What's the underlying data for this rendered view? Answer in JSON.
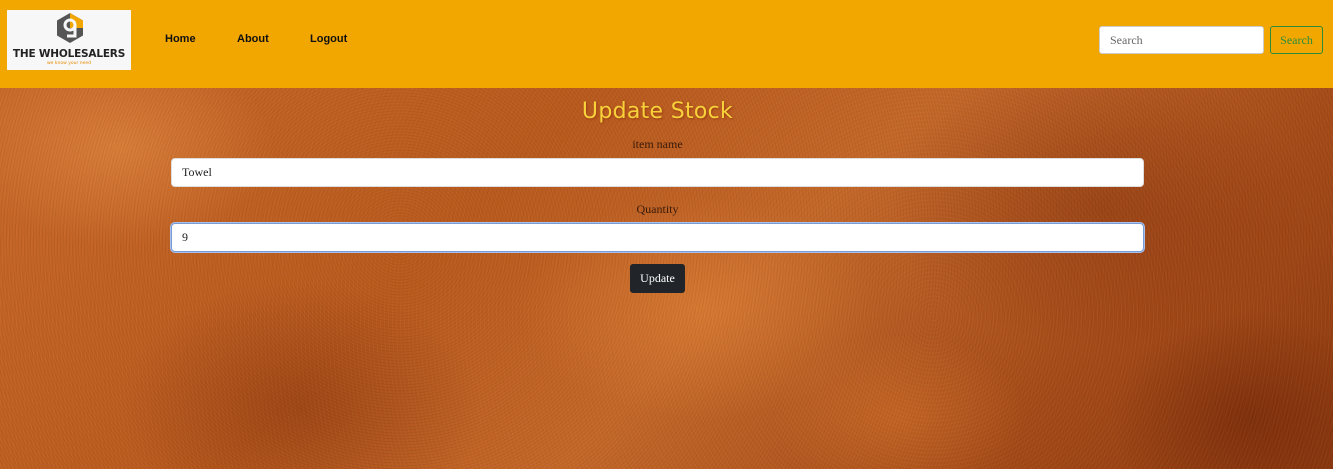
{
  "navbar": {
    "logo": {
      "title": "THE WHOLESALERS",
      "tagline": "we know your need",
      "icon": "hexagon-9-logo-icon"
    },
    "links": [
      {
        "label": "Home"
      },
      {
        "label": "About"
      },
      {
        "label": "Logout"
      }
    ],
    "search": {
      "placeholder": "Search",
      "value": "",
      "button_label": "Search"
    },
    "colors": {
      "background": "#f2a700",
      "search_button": "#2c8c3c"
    }
  },
  "main": {
    "title": "Update Stock",
    "title_color": "#f7d23a",
    "form": {
      "item_name": {
        "label": "item name",
        "value": "Towel"
      },
      "quantity": {
        "label": "Quantity",
        "value": "9"
      },
      "submit_label": "Update"
    }
  }
}
